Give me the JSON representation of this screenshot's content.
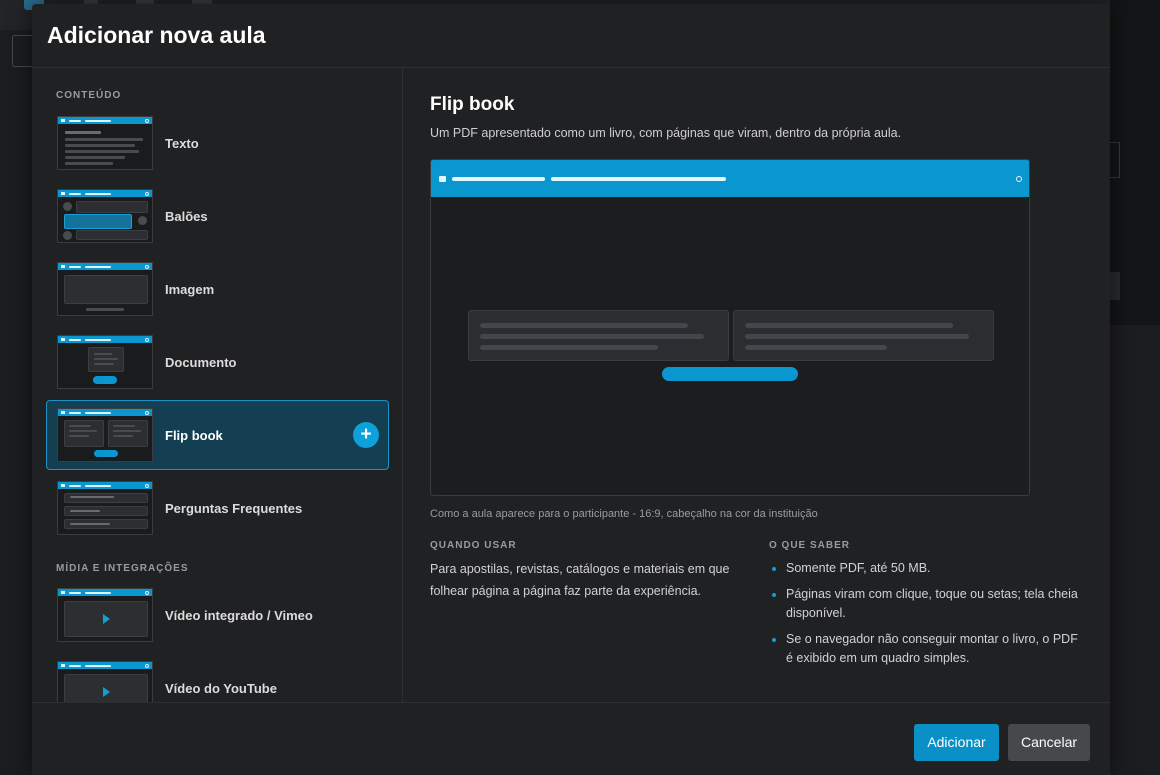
{
  "modal": {
    "title": "Adicionar nova aula"
  },
  "sidebar": {
    "section_content": "CONTEÚDO",
    "section_media": "MÍDIA E INTEGRAÇÕES",
    "items": [
      {
        "label": "Texto"
      },
      {
        "label": "Balões"
      },
      {
        "label": "Imagem"
      },
      {
        "label": "Documento"
      },
      {
        "label": "Flip book",
        "selected": true
      },
      {
        "label": "Perguntas Frequentes"
      },
      {
        "label": "Vídeo integrado / Vimeo"
      },
      {
        "label": "Vídeo do YouTube"
      }
    ],
    "add_symbol": "+"
  },
  "detail": {
    "title": "Flip book",
    "description": "Um PDF apresentado como um livro, com páginas que viram, dentro da própria aula.",
    "caption": "Como a aula aparece para o participante - 16:9, cabeçalho na cor da instituição",
    "when_heading": "QUANDO USAR",
    "when_text": "Para apostilas, revistas, catálogos e materiais em que folhear página a página faz parte da experiência.",
    "know_heading": "O QUE SABER",
    "know_items": [
      "Somente PDF, até 50 MB.",
      "Páginas viram com clique, toque ou setas; tela cheia disponível.",
      "Se o navegador não conseguir montar o livro, o PDF é exibido em um quadro simples."
    ]
  },
  "footer": {
    "add_label": "Adicionar",
    "cancel_label": "Cancelar"
  },
  "colors": {
    "accent": "#0a96cf",
    "selected_bg": "#143f53",
    "background": "#202123"
  }
}
